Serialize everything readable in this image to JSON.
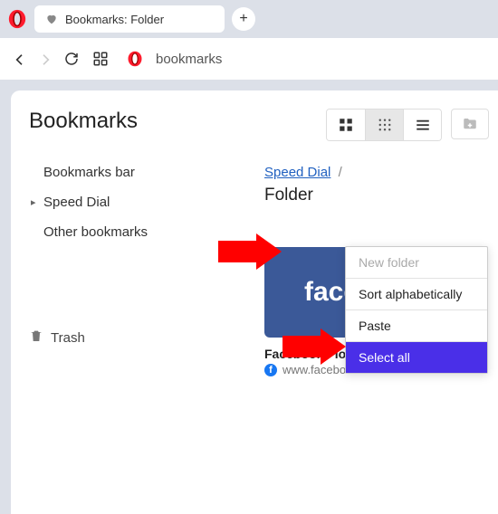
{
  "tab": {
    "title": "Bookmarks: Folder"
  },
  "addressbar": {
    "text": "bookmarks"
  },
  "page": {
    "title": "Bookmarks"
  },
  "sidebar": {
    "items": [
      {
        "label": "Bookmarks bar"
      },
      {
        "label": "Speed Dial"
      },
      {
        "label": "Other bookmarks"
      }
    ],
    "trash_label": "Trash"
  },
  "breadcrumb": {
    "parent": "Speed Dial",
    "sep": "/",
    "current": "Folder"
  },
  "bookmark": {
    "thumb_text": "face",
    "title": "Facebook - log in or sign...",
    "url": "www.facebook.com"
  },
  "context_menu": {
    "items": [
      {
        "label": "New folder",
        "state": "disabled"
      },
      {
        "label": "Sort alphabetically",
        "state": ""
      },
      {
        "label": "Paste",
        "state": ""
      },
      {
        "label": "Select all",
        "state": "highlight"
      }
    ]
  }
}
